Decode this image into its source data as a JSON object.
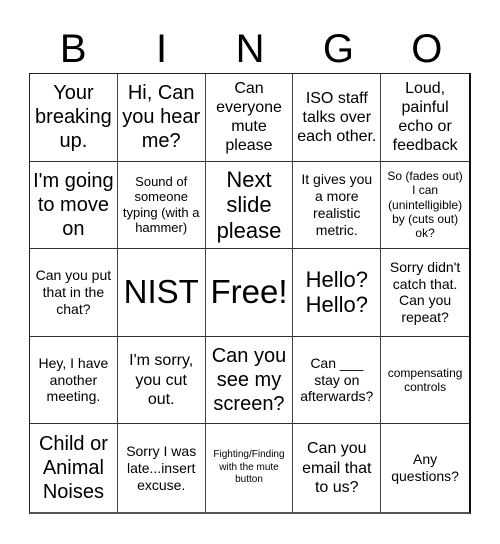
{
  "header": {
    "letters": [
      "B",
      "I",
      "N",
      "G",
      "O"
    ]
  },
  "card": {
    "cells": [
      {
        "text": "Your breaking up."
      },
      {
        "text": "Hi, Can you hear me?"
      },
      {
        "text": "Can everyone mute please"
      },
      {
        "text": "ISO staff talks over each other."
      },
      {
        "text": "Loud, painful echo or feedback"
      },
      {
        "text": "I'm going to move on"
      },
      {
        "text": "Sound of someone typing (with a hammer)"
      },
      {
        "text": "Next slide please"
      },
      {
        "text": "It gives you a more realistic metric."
      },
      {
        "text": "So (fades out) I can (unintelligible) by (cuts out) ok?"
      },
      {
        "text": "Can you put that in the chat?"
      },
      {
        "text": "NIST"
      },
      {
        "text": "Free!"
      },
      {
        "text": "Hello? Hello?"
      },
      {
        "text": "Sorry didn't catch that. Can you repeat?"
      },
      {
        "text": "Hey, I have another meeting."
      },
      {
        "text": "I'm sorry, you cut out."
      },
      {
        "text": "Can you see my screen?"
      },
      {
        "text": "Can ___ stay on afterwards?"
      },
      {
        "text": "compensating controls"
      },
      {
        "text": "Child or Animal Noises"
      },
      {
        "text": "Sorry I was late...insert excuse."
      },
      {
        "text": "Fighting/Finding with the mute button"
      },
      {
        "text": "Can you email that to us?"
      },
      {
        "text": "Any questions?"
      }
    ]
  }
}
